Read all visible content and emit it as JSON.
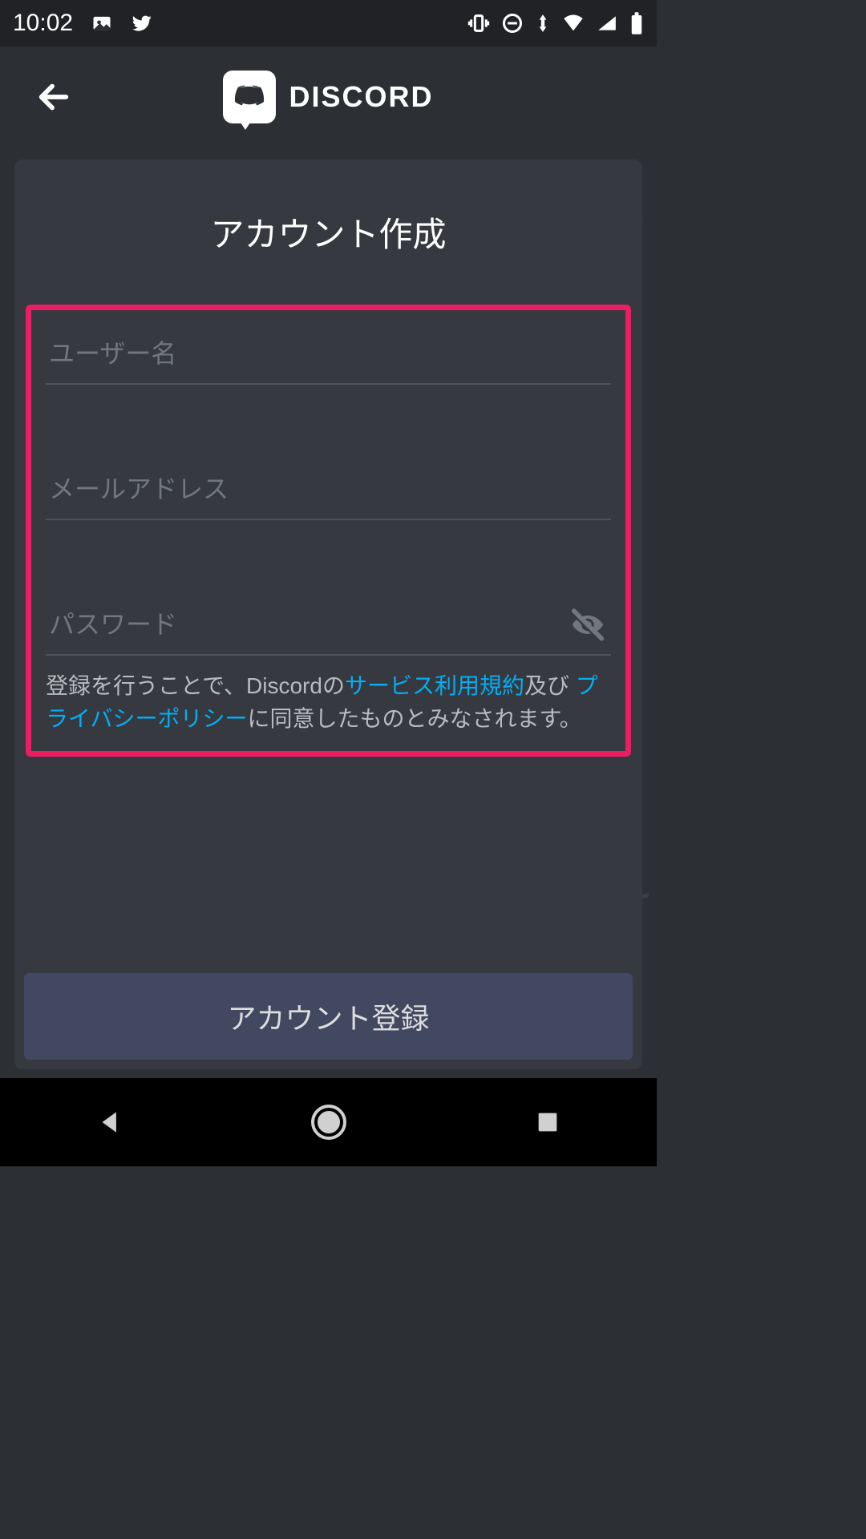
{
  "status_bar": {
    "time": "10:02"
  },
  "header": {
    "brand": "DISCORD"
  },
  "card": {
    "title": "アカウント作成",
    "fields": {
      "username_placeholder": "ユーザー名",
      "email_placeholder": "メールアドレス",
      "password_placeholder": "パスワード"
    },
    "terms": {
      "prefix": "登録を行うことで、Discordの",
      "tos": "サービス利用規約",
      "mid": "及び ",
      "privacy": "プライバシーポリシー",
      "suffix": "に同意したものとみなされます。"
    },
    "register_button": "アカウント登録"
  }
}
